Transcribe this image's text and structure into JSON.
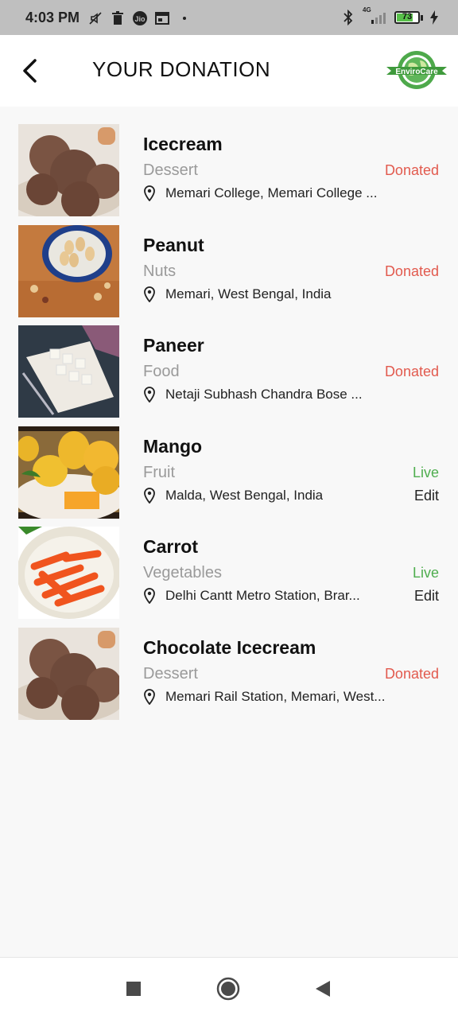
{
  "status_bar": {
    "time": "4:03 PM",
    "network": "4G",
    "battery": "73",
    "icons": [
      "mute-icon",
      "trash-icon",
      "jio-icon",
      "calendar-icon",
      "dot-icon",
      "bluetooth-icon",
      "signal-icon",
      "battery-icon",
      "charging-icon"
    ]
  },
  "header": {
    "title": "YOUR DONATION",
    "logo_text": "EnviroCare"
  },
  "donations": [
    {
      "name": "Icecream",
      "category": "Dessert",
      "status": "Donated",
      "location": "Memari College, Memari College ...",
      "edit": ""
    },
    {
      "name": "Peanut",
      "category": "Nuts",
      "status": "Donated",
      "location": "Memari, West Bengal, India",
      "edit": ""
    },
    {
      "name": "Paneer",
      "category": "Food",
      "status": "Donated",
      "location": "Netaji Subhash Chandra Bose ...",
      "edit": ""
    },
    {
      "name": "Mango",
      "category": "Fruit",
      "status": "Live",
      "location": "Malda, West Bengal, India",
      "edit": "Edit"
    },
    {
      "name": "Carrot",
      "category": "Vegetables",
      "status": "Live",
      "location": "Delhi Cantt Metro Station, Brar...",
      "edit": "Edit"
    },
    {
      "name": "Chocolate Icecream",
      "category": "Dessert",
      "status": "Donated",
      "location": "Memari Rail Station, Memari, West...",
      "edit": ""
    }
  ],
  "colors": {
    "donated": "#e25a4e",
    "live": "#4fae4f",
    "category": "#9a9a9a",
    "status_bar": "#bfbfbf"
  },
  "nav": {
    "icons": [
      "recents-square-icon",
      "home-circle-icon",
      "back-triangle-icon"
    ]
  }
}
